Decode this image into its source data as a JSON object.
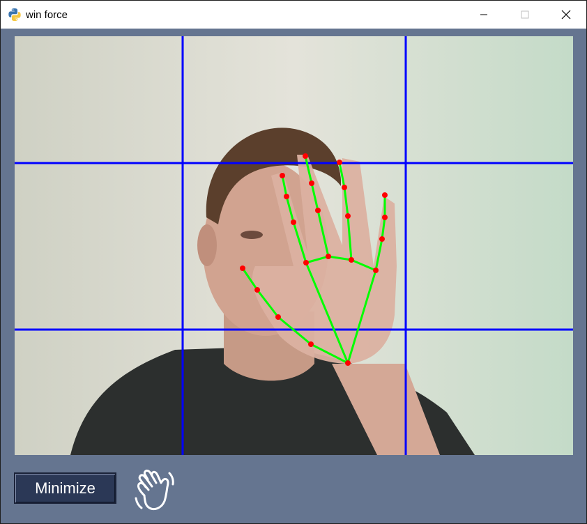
{
  "window": {
    "title": "win force",
    "app_icon": "python-icon",
    "controls": [
      "minimize-icon",
      "maximize-icon",
      "close-icon"
    ]
  },
  "camera_feed": {
    "description_icon": "webcam-feed",
    "grid_color": "#0000ff",
    "landmark_color": "#ff0000",
    "connection_color": "#00ff00"
  },
  "footer": {
    "minimize_label": "Minimize",
    "gesture_icon": "waving-hand-icon"
  },
  "colors": {
    "window_bg": "#657590",
    "button_bg": "#2b3856"
  }
}
